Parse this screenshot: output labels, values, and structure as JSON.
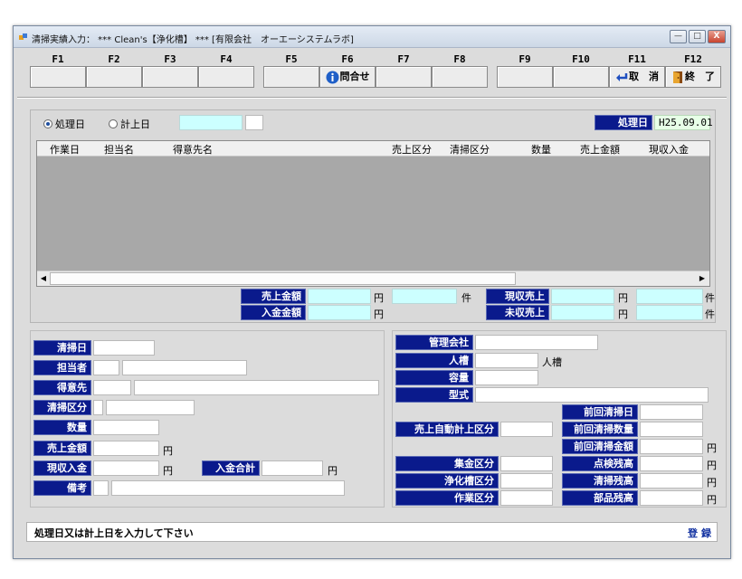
{
  "window": {
    "title": "清掃実績入力： *** Clean's【浄化槽】 *** [有限会社　オーエーシステムラボ]",
    "controls": {
      "minimize": "—",
      "restore": "□",
      "close": "X"
    }
  },
  "fkeys": [
    {
      "key": "F1",
      "label": ""
    },
    {
      "key": "F2",
      "label": ""
    },
    {
      "key": "F3",
      "label": ""
    },
    {
      "key": "F4",
      "label": ""
    },
    {
      "key": "F5",
      "label": ""
    },
    {
      "key": "F6",
      "label": "問合せ",
      "icon": "info-icon"
    },
    {
      "key": "F7",
      "label": ""
    },
    {
      "key": "F8",
      "label": ""
    },
    {
      "key": "F9",
      "label": ""
    },
    {
      "key": "F10",
      "label": ""
    },
    {
      "key": "F11",
      "label": "取　消",
      "icon": "undo-arrow-icon"
    },
    {
      "key": "F12",
      "label": "終　了",
      "icon": "exit-door-icon"
    }
  ],
  "filter": {
    "radio_processing_date": "処理日",
    "radio_posting_date": "計上日",
    "selected": "処理日",
    "processing_date_label": "処理日",
    "processing_date_value": "H25.09.01"
  },
  "grid": {
    "columns": [
      "作業日",
      "担当名",
      "得意先名",
      "売上区分",
      "清掃区分",
      "数量",
      "売上金額",
      "現収入金"
    ],
    "rows": []
  },
  "summary": {
    "sales_amount_label": "売上金額",
    "payment_amount_label": "入金金額",
    "cash_sales_label": "現収売上",
    "unpaid_sales_label": "未収売上",
    "yen": "円",
    "count_unit": "件"
  },
  "form_left": {
    "cleaning_date": "清掃日",
    "staff": "担当者",
    "customer": "得意先",
    "cleaning_type": "清掃区分",
    "quantity": "数量",
    "sales_amount": "売上金額",
    "cash_received": "現収入金",
    "payment_total": "入金合計",
    "remarks": "備考",
    "yen": "円"
  },
  "form_right": {
    "management_company": "管理会社",
    "persons_tank": "人槽",
    "persons_tank_unit": "人槽",
    "capacity": "容量",
    "model": "型式",
    "prev_cleaning_date": "前回清掃日",
    "auto_posting_type": "売上自動計上区分",
    "prev_cleaning_qty": "前回清掃数量",
    "prev_cleaning_amount": "前回清掃金額",
    "collection_type": "集金区分",
    "inspection_balance": "点検残高",
    "tank_type": "浄化槽区分",
    "cleaning_balance": "清掃残高",
    "work_type": "作業区分",
    "parts_balance": "部品残高",
    "yen": "円"
  },
  "status": {
    "message": "処理日又は計上日を入力して下さい",
    "register": "登録"
  }
}
